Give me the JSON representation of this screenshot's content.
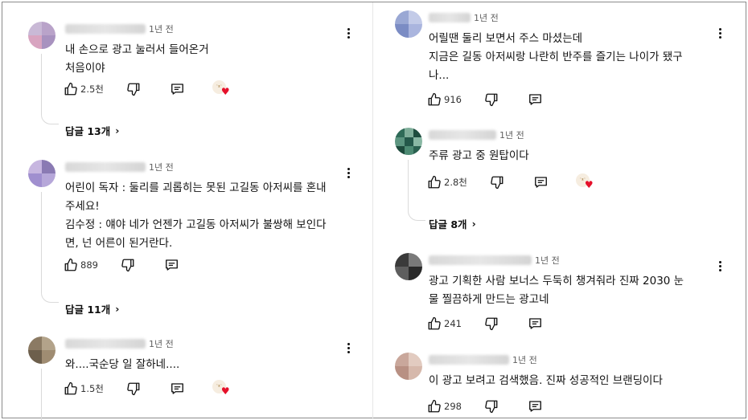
{
  "left_column": {
    "comments": [
      {
        "time": "1년 전",
        "text": "내 손으로 광고 눌러서 들어온거\n처음이야",
        "likes": "2.5천",
        "has_creator_heart": true,
        "replies_label": "답글 13개"
      },
      {
        "time": "1년 전",
        "text": "어린이 독자 : 둘리를 괴롭히는 못된 고길동 아저씨를 혼내\n주세요!\n김수정 : 얘야 네가 언젠가 고길동 아저씨가 불쌍해 보인다\n면, 넌 어른이 된거란다.",
        "likes": "889",
        "has_creator_heart": false,
        "replies_label": "답글 11개"
      },
      {
        "time": "1년 전",
        "text": "와....국순당 일 잘하네....",
        "likes": "1.5천",
        "has_creator_heart": true,
        "replies_label": ""
      }
    ]
  },
  "right_column": {
    "comments": [
      {
        "time": "1년 전",
        "text": "어릴땐 둘리 보면서 주스 마셨는데\n지금은 길동 아저씨랑 나란히 반주를 즐기는 나이가 됐구\n나...",
        "likes": "916",
        "has_creator_heart": false,
        "replies_label": ""
      },
      {
        "time": "1년 전",
        "text": "주류 광고 중 원탑이다",
        "likes": "2.8천",
        "has_creator_heart": true,
        "replies_label": "답글 8개"
      },
      {
        "time": "1년 전",
        "text": "광고 기획한 사람 보너스 두둑히 챙겨줘라 진짜 2030 눈\n물 찔끔하게 만드는 광고네",
        "likes": "241",
        "has_creator_heart": false,
        "replies_label": ""
      },
      {
        "time": "1년 전",
        "text": "이 광고 보려고 검색했음. 진짜 성공적인 브랜딩이다",
        "likes": "298",
        "has_creator_heart": false,
        "replies_label": ""
      }
    ]
  },
  "icons": {
    "like": "thumbs-up-icon",
    "dislike": "thumbs-down-icon",
    "reply": "comment-bubble-icon",
    "menu": "more-vertical-icon",
    "heart": "creator-heart-icon",
    "replies_chevron": "chevron-right-icon"
  },
  "colors": {
    "heart": "#e5102a",
    "text": "#0f0f0f",
    "meta": "#606060",
    "thread_line": "#dadada"
  }
}
